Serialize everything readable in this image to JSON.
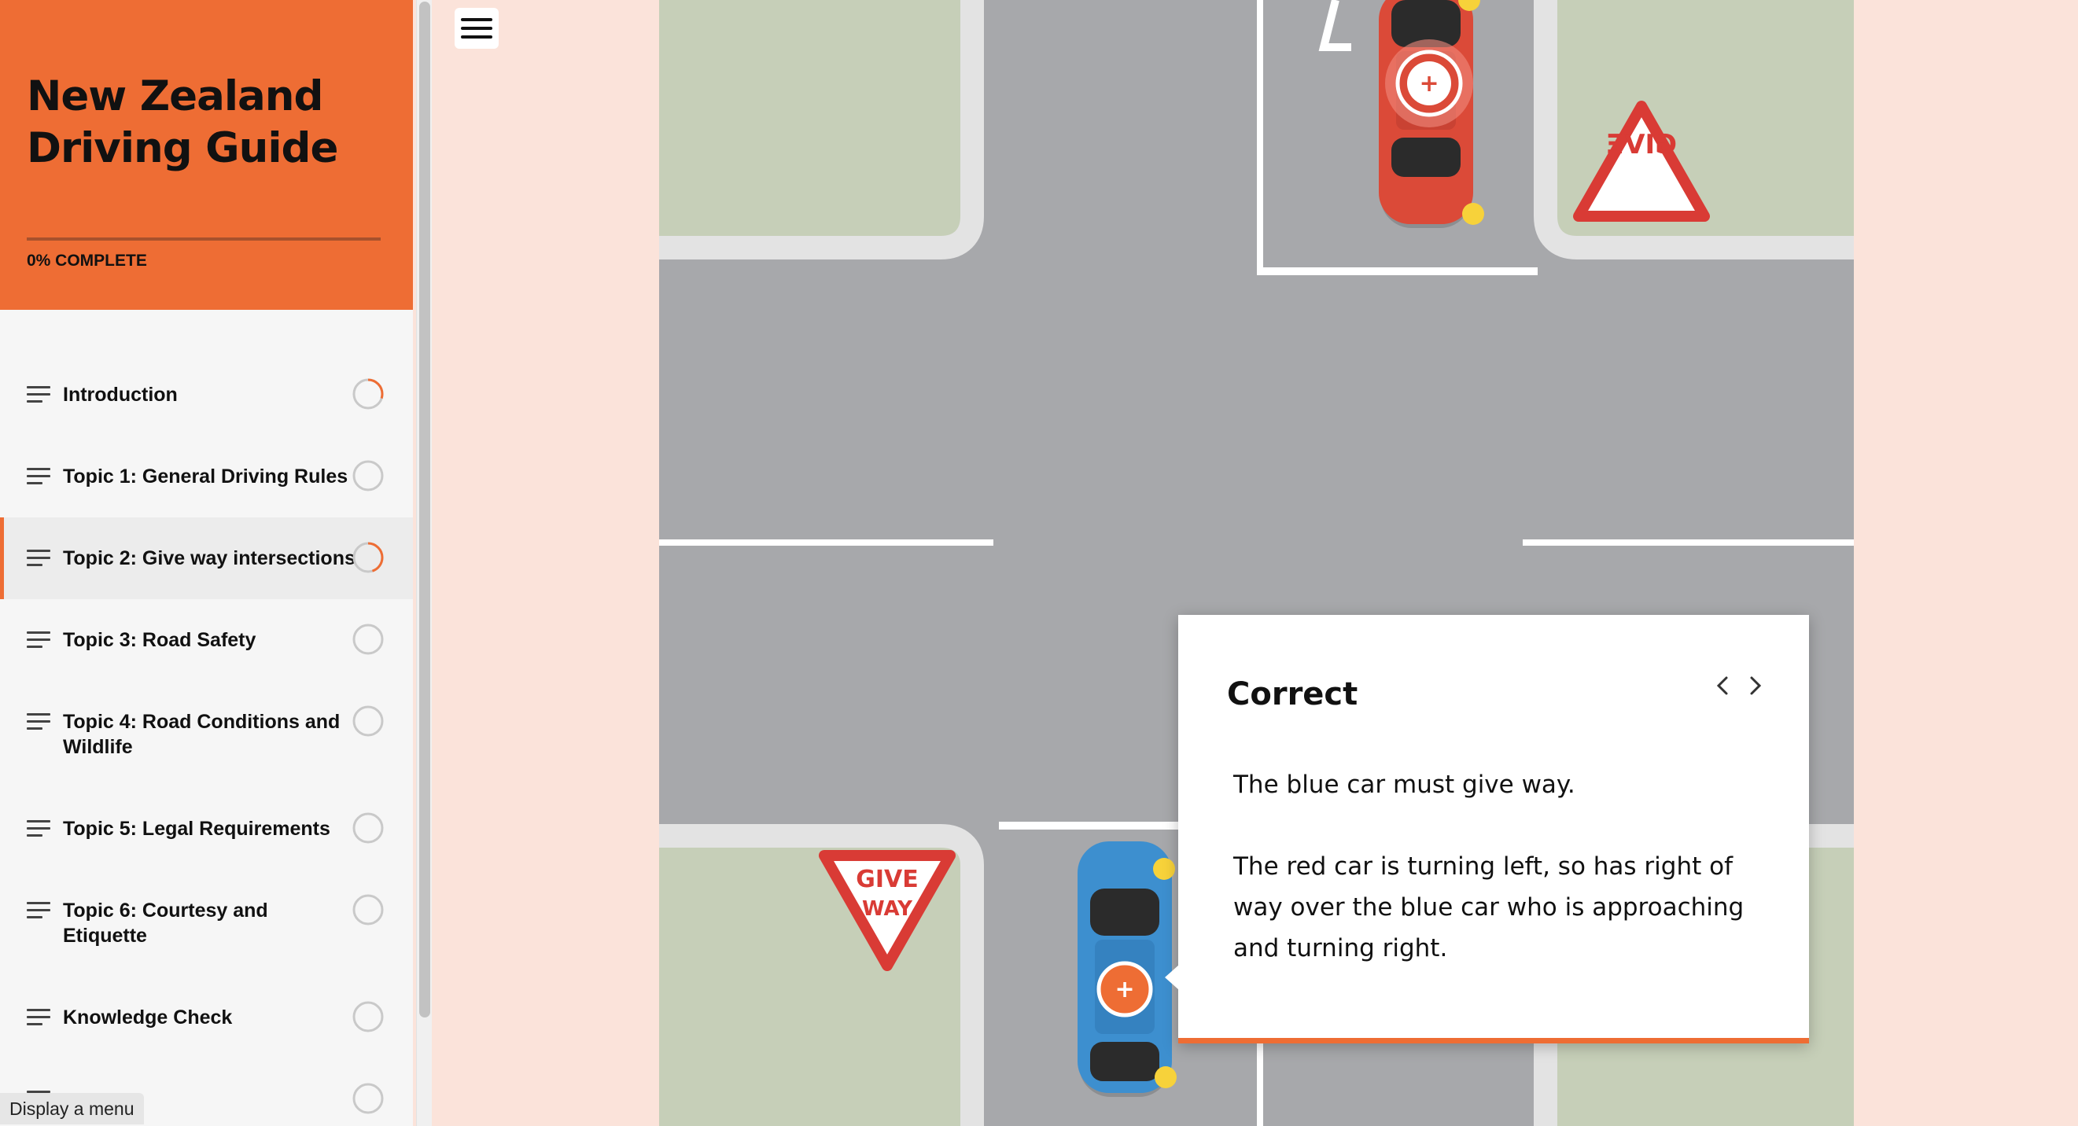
{
  "course": {
    "title_line1": "New Zealand",
    "title_line2": "Driving Guide",
    "progress_label": "0% COMPLETE",
    "progress_fraction": 0
  },
  "lessons": [
    {
      "label_line1": "Introduction",
      "label_line2": "",
      "status": "in-progress",
      "progress": 0.3,
      "active": false
    },
    {
      "label_line1": "Topic 1: General Driving Rules",
      "label_line2": "",
      "status": "not-started",
      "progress": 0,
      "active": false
    },
    {
      "label_line1": "Topic 2: Give way intersections",
      "label_line2": "",
      "status": "in-progress",
      "progress": 0.45,
      "active": true
    },
    {
      "label_line1": "Topic 3: Road Safety",
      "label_line2": "",
      "status": "not-started",
      "progress": 0,
      "active": false
    },
    {
      "label_line1": "Topic 4: Road Conditions and",
      "label_line2": "Wildlife",
      "status": "not-started",
      "progress": 0,
      "active": false
    },
    {
      "label_line1": "Topic 5: Legal Requirements",
      "label_line2": "",
      "status": "not-started",
      "progress": 0,
      "active": false
    },
    {
      "label_line1": "Topic 6: Courtesy and",
      "label_line2": "Etiquette",
      "status": "not-started",
      "progress": 0,
      "active": false
    },
    {
      "label_line1": "Knowledge Check",
      "label_line2": "",
      "status": "not-started",
      "progress": 0,
      "active": false
    }
  ],
  "menu_tooltip": "Display a menu",
  "signs": {
    "top_right": "GIVE",
    "bottom_left_line1": "GIVE",
    "bottom_left_line2": "WAY"
  },
  "popup": {
    "title": "Correct",
    "paragraph1": "The blue car must give way.",
    "paragraph2_line1": "The red car is turning left, so has right of",
    "paragraph2_line2": "way over the blue car who is  approaching",
    "paragraph2_line3": "and turning right.",
    "prev_icon": "chevron-left-icon",
    "next_icon": "chevron-right-icon"
  },
  "colors": {
    "accent": "#ee6d34",
    "background": "#fbe3da",
    "road": "#a7a8ab",
    "grass": "#c6cfb8",
    "red_car": "#db4a38",
    "blue_car": "#3d8fcf"
  }
}
